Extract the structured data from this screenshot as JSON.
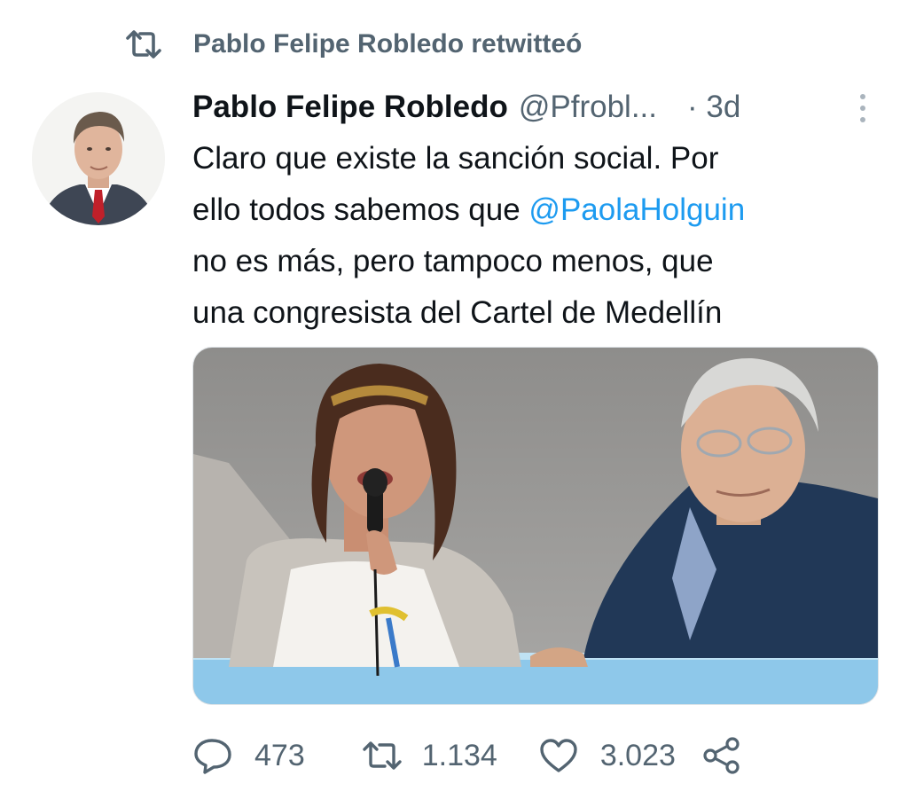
{
  "retweet": {
    "icon": "retweet-icon",
    "label": "Pablo Felipe Robledo retwitteó"
  },
  "tweet": {
    "author": {
      "display_name": "Pablo Felipe Robledo",
      "handle": "@Pfrobl...",
      "avatar_icon": "avatar"
    },
    "time": "· 3d",
    "text_lines": {
      "line1": "Claro que existe la sanción social. Por",
      "line2_before": "ello todos sabemos que ",
      "mention": "@PaolaHolguin",
      "line3": "no es más, pero tampoco menos, que",
      "line4": "una congresista del Cartel de Medellín"
    },
    "media": {
      "type": "photo"
    }
  },
  "actions": {
    "reply": {
      "icon": "reply-icon",
      "count": "473"
    },
    "retweet": {
      "icon": "retweet-icon",
      "count": "1.134"
    },
    "like": {
      "icon": "heart-icon",
      "count": "3.023"
    },
    "share": {
      "icon": "share-icon"
    }
  },
  "colors": {
    "text": "#0f1419",
    "secondary": "#536471",
    "link": "#1d9bf0",
    "background": "#ffffff"
  }
}
